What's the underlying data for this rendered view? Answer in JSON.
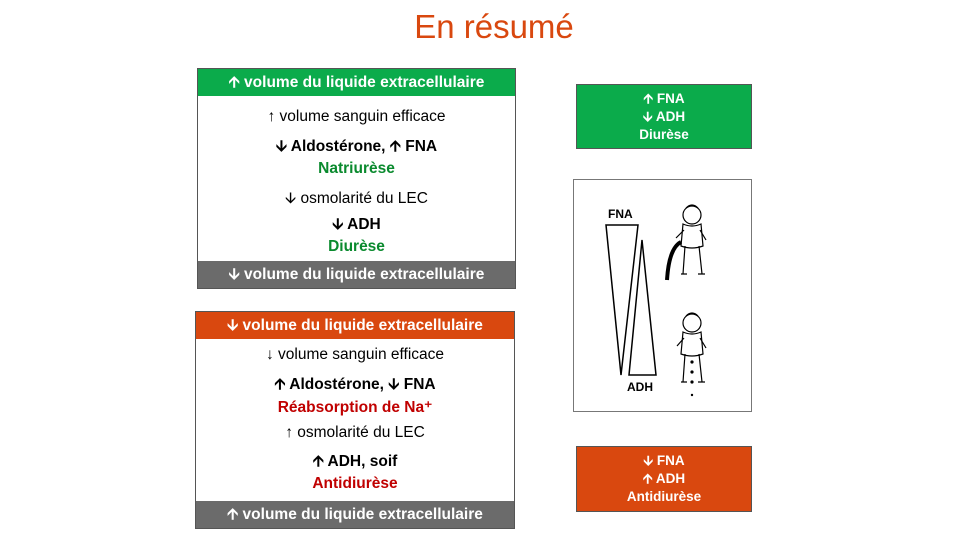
{
  "title": "En résumé",
  "top_box": {
    "header": "🡩 volume du liquide extracellulaire",
    "lines": [
      "↑ volume sanguin efficace",
      "🡫 Aldostérone, 🡩 FNA",
      "Natriurèse",
      "🡫 osmolarité du LEC",
      "🡫 ADH",
      "Diurèse"
    ],
    "footer": "🡫 volume du liquide extracellulaire"
  },
  "bottom_box": {
    "header": "🡫 volume du liquide extracellulaire",
    "lines": [
      "↓  volume sanguin efficace",
      "🡩 Aldostérone, 🡫 FNA",
      "Réabsorption de Na⁺",
      "↑ osmolarité du LEC",
      "🡩 ADH, soif",
      "Antidiurèse"
    ],
    "footer": "🡩 volume du liquide extracellulaire"
  },
  "side_top": [
    "🡩 FNA",
    "🡫 ADH",
    "Diurèse"
  ],
  "side_bottom": [
    "🡫 FNA",
    "🡩 ADH",
    "Antidiurèse"
  ],
  "illustration": {
    "label_top": "FNA",
    "label_bottom": "ADH"
  },
  "colors": {
    "title": "#d9480f",
    "green": "#0bab4b",
    "grey": "#6b6b6b",
    "red": "#d9480f",
    "text_green": "#0a8a2e",
    "text_red": "#c00000"
  }
}
